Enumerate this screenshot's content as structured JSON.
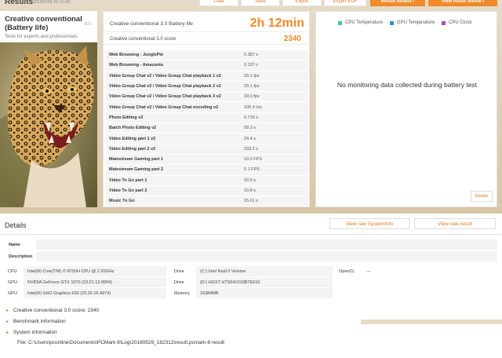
{
  "header": {
    "title": "Results",
    "date": "2018/5/29 20:10:46",
    "buttons": {
      "load": "Load",
      "save": "Save",
      "export": "Export",
      "export_pdf": "Export PDF",
      "result_details": "Result details ›",
      "view_online": "View result online ›"
    }
  },
  "test": {
    "name": "Creative conventional (Battery life)",
    "version": "8.0",
    "subtitle": "Tests for experts and professionals"
  },
  "summary": {
    "battery_label": "Creative conventional 3.0 Battery life",
    "battery_value": "2h 12min",
    "score_label": "Creative conventional 3.0 score",
    "score_value": "2340"
  },
  "subtests": [
    {
      "name": "Web Browsing - JunglePin",
      "value": "0.387 s"
    },
    {
      "name": "Web Browsing - Amazonia",
      "value": "0.137 s"
    },
    {
      "name": "Video Group Chat v2 / Video Group Chat playback 1 v2",
      "value": "29.1 fps"
    },
    {
      "name": "Video Group Chat v2 / Video Group Chat playback 2 v2",
      "value": "29.1 fps"
    },
    {
      "name": "Video Group Chat v2 / Video Group Chat playback 3 v2",
      "value": "29.0 fps"
    },
    {
      "name": "Video Group Chat v2 / Video Group Chat encoding v2",
      "value": "105.4 ms"
    },
    {
      "name": "Photo Editing v2",
      "value": "0.716 s"
    },
    {
      "name": "Batch Photo Editing v2",
      "value": "58.3 s"
    },
    {
      "name": "Video Editing part 1 v2",
      "value": "24.4 s"
    },
    {
      "name": "Video Editing part 2 v2",
      "value": "333.2 s"
    },
    {
      "name": "Mainstream Gaming part 1",
      "value": "10.3 FPS"
    },
    {
      "name": "Mainstream Gaming part 2",
      "value": "5.1 FPS"
    },
    {
      "name": "Video To Go part 1",
      "value": "10.0 s"
    },
    {
      "name": "Video To Go part 2",
      "value": "10.8 s"
    },
    {
      "name": "Music To Go",
      "value": "15.61 s"
    }
  ],
  "monitoring": {
    "legend": [
      {
        "label": "CPU Temperature",
        "color": "#3cc8b4"
      },
      {
        "label": "GPU Temperature",
        "color": "#2f8fd8"
      },
      {
        "label": "CPU Clock",
        "color": "#9b59c6"
      }
    ],
    "no_data": "No monitoring data collected during battery test",
    "details_button": "Details"
  },
  "details": {
    "title": "Details",
    "view_systeminfo": "View raw SystemInfo",
    "view_result": "View raw result",
    "name_label": "Name",
    "description_label": "Description",
    "cpu_label": "CPU",
    "cpu_value": "Intel(R) Core(TM) i7-8750H CPU @ 2.20GHz",
    "gpu1_label": "GPU",
    "gpu1_value": "NVIDIA GeForce GTX 1070 (23.21.13.8904)",
    "gpu2_label": "GPU",
    "gpu2_value": "Intel(R) UHD Graphics 630 (23.20.16.4974)",
    "drive1_label": "Drive",
    "drive1_value": "(C:) Intel Raid 0 Volume",
    "drive2_label": "Drive",
    "drive2_value": "(D:) HGST HTS541010B7E610",
    "memory_label": "Memory",
    "memory_value": "16384MB",
    "opencl_label": "OpenCL",
    "opencl_value": "---",
    "tree": [
      "Creative conventional 3.0 score: 2340",
      "Benchmark information",
      "System information"
    ],
    "file_path": "File: C:\\Users\\pconline\\Documents\\PCMark 8\\Log\\20180529_182312\\result.pcmark-8-result"
  }
}
